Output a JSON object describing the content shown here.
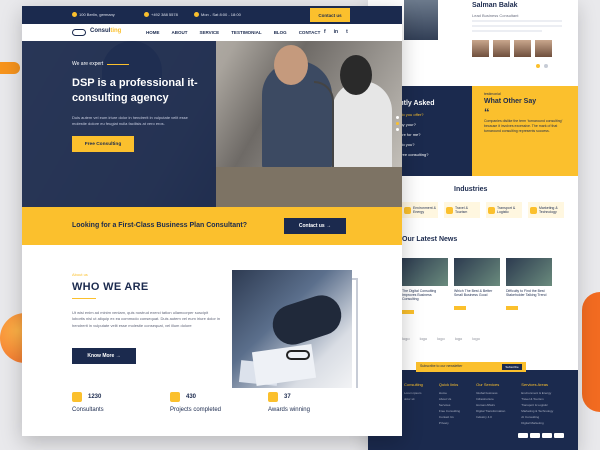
{
  "colors": {
    "navy": "#1b2a4e",
    "yellow": "#fbc02d",
    "orange": "#f26b21"
  },
  "topbar": {
    "address": "100 Berlin, germany",
    "phone": "+492 388 5578",
    "hours": "Mon - Sat 8:00 - 18:00",
    "contact_label": "Contact us"
  },
  "nav": {
    "logo_main": "Consul",
    "logo_accent": "ting",
    "links": [
      "HOME",
      "ABOUT",
      "SERVICE",
      "TESTIMONIAL",
      "BLOG",
      "CONTACT"
    ],
    "social_icons": [
      "facebook-icon",
      "linkedin-icon",
      "twitter-icon"
    ],
    "social_glyphs": [
      "f",
      "in",
      "t"
    ]
  },
  "hero": {
    "eyebrow": "We are expert",
    "title": "DSP is a professional it-consulting agency",
    "description": "Duis autem vel eum iriure dolor in hendrerit in vulputate velit esse molestie dolore eu feugiat nulla facilisis at vero eros.",
    "button": "Free Consulting"
  },
  "cta": {
    "text": "Looking for a First-Class Business Plan Consultant?",
    "button": "Contact us →"
  },
  "about": {
    "eyebrow": "About us",
    "title": "WHO WE ARE",
    "description": "Ut wisi enim ad minim veniam, quis nostrud exerci tation ullamcorper suscipit lobortis nisl ut aliquip ex ea commodo consequat. Duis autem vel eum iriure dolor in hendrerit in vulputate velit esse molestie consequat, vel illum dolore",
    "button": "Know More →"
  },
  "stats": [
    {
      "value": "1230",
      "label": "Consultants",
      "icon": "consultant-icon"
    },
    {
      "value": "430",
      "label": "Projects completed",
      "icon": "projects-icon"
    },
    {
      "value": "37",
      "label": "Awards winning",
      "icon": "award-icon"
    }
  ],
  "back": {
    "team_name": "Salman Balak",
    "team_role": "Lead Business Consultant",
    "faq_title": "Frequently Asked",
    "faq_questions": [
      "Lorem ipsum do you offer?",
      "How do you pay your?",
      "Can you prepare for me?",
      "Lorem ipsum do you?",
      "Lorem ipsum free consulting?"
    ],
    "testimonial_eyebrow": "testimonial",
    "testimonial_title": "What Other Say",
    "testimonial_text": "Companies dislike the term ‘turnaround consulting’ because it involves excessive. The mark of that turnaround consulting represents success.",
    "industries_title": "Industries",
    "industries": [
      "Environment & Energy",
      "Travel & Tourism",
      "Transport & Logistic",
      "Marketing & Technology"
    ],
    "news_title": "Our Latest News",
    "news": [
      "The Digital Consulting Improves Business Consulting",
      "Which The Best & Better Small Business Good",
      "Difficulty to Find the Best Stakeholder Talking Trend"
    ],
    "logos": [
      "logo",
      "logo",
      "logo",
      "logo",
      "logo"
    ],
    "subscribe_text": "Subscribe to our newsletter",
    "subscribe_button": "Subscribe",
    "footer_cols": [
      {
        "title": "Consulting",
        "links": [
          "Lorem ipsum",
          "dolor sit"
        ]
      },
      {
        "title": "Quick links",
        "links": [
          "Home",
          "About Us",
          "Services",
          "Free Consulting",
          "Contact Us",
          "Privacy"
        ]
      },
      {
        "title": "Our Services",
        "links": [
          "Global business",
          "Infrastructure",
          "Human Affairs",
          "Digital Transformation",
          "Industry 4.0"
        ]
      },
      {
        "title": "Services Areas",
        "links": [
          "Environment & Energy",
          "Travel & Tourism",
          "Transport & Logistic",
          "Marketing & Technology",
          "AI Consulting",
          "Digital Marketing"
        ]
      }
    ]
  }
}
